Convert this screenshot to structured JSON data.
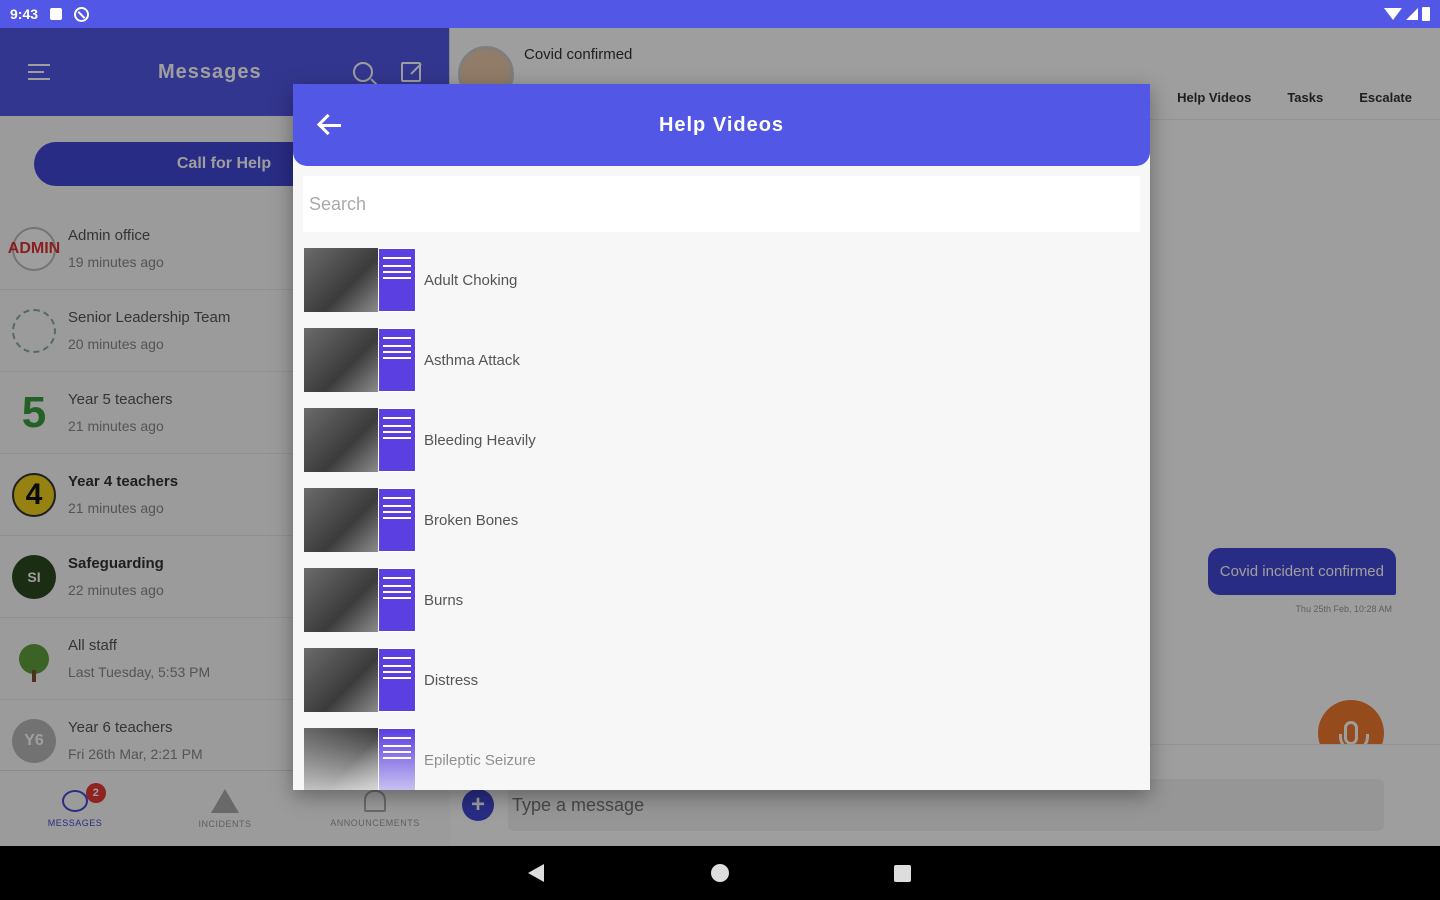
{
  "status_bar": {
    "time": "9:43"
  },
  "sidebar": {
    "title": "Messages",
    "call_for_help": "Call for Help",
    "conversations": [
      {
        "name": "Admin office",
        "time": "19 minutes ago",
        "avatar": "ADMIN",
        "bold": false
      },
      {
        "name": "Senior Leadership Team",
        "time": "20 minutes ago",
        "avatar": "",
        "bold": false
      },
      {
        "name": "Year 5 teachers",
        "time": "21 minutes ago",
        "avatar": "5",
        "bold": false
      },
      {
        "name": "Year 4 teachers",
        "time": "21 minutes ago",
        "avatar": "4",
        "bold": true
      },
      {
        "name": "Safeguarding",
        "time": "22 minutes ago",
        "avatar": "SI",
        "bold": true
      },
      {
        "name": "All staff",
        "time": "Last Tuesday, 5:53 PM",
        "avatar": "",
        "bold": false
      },
      {
        "name": "Year 6 teachers",
        "time": "Fri 26th Mar, 2:21 PM",
        "avatar": "Y6",
        "bold": false
      }
    ],
    "bottom_nav": {
      "messages": "MESSAGES",
      "incidents": "INCIDENTS",
      "announcements": "ANNOUNCEMENTS",
      "badge_count": "2"
    }
  },
  "chat": {
    "title": "Covid confirmed",
    "tabs": [
      "Help Videos",
      "Tasks",
      "Escalate"
    ],
    "message": "Covid incident confirmed",
    "message_meta": "Thu 25th Feb, 10:28 AM",
    "input_placeholder": "Type a message",
    "add_label": "+"
  },
  "modal": {
    "title": "Help Videos",
    "search_placeholder": "Search",
    "videos": [
      {
        "label": "Adult Choking"
      },
      {
        "label": "Asthma Attack"
      },
      {
        "label": "Bleeding Heavily"
      },
      {
        "label": "Broken Bones"
      },
      {
        "label": "Burns"
      },
      {
        "label": "Distress"
      },
      {
        "label": "Epileptic Seizure"
      }
    ]
  },
  "colors": {
    "brand": "#5357e6",
    "accent_dark": "#4347d6",
    "mic": "#f07a2e",
    "badge": "#e53935"
  },
  "icons": {
    "menu": "hamburger-icon",
    "search": "search-icon",
    "compose": "compose-icon",
    "back": "arrow-left-icon",
    "mic": "microphone-icon"
  }
}
